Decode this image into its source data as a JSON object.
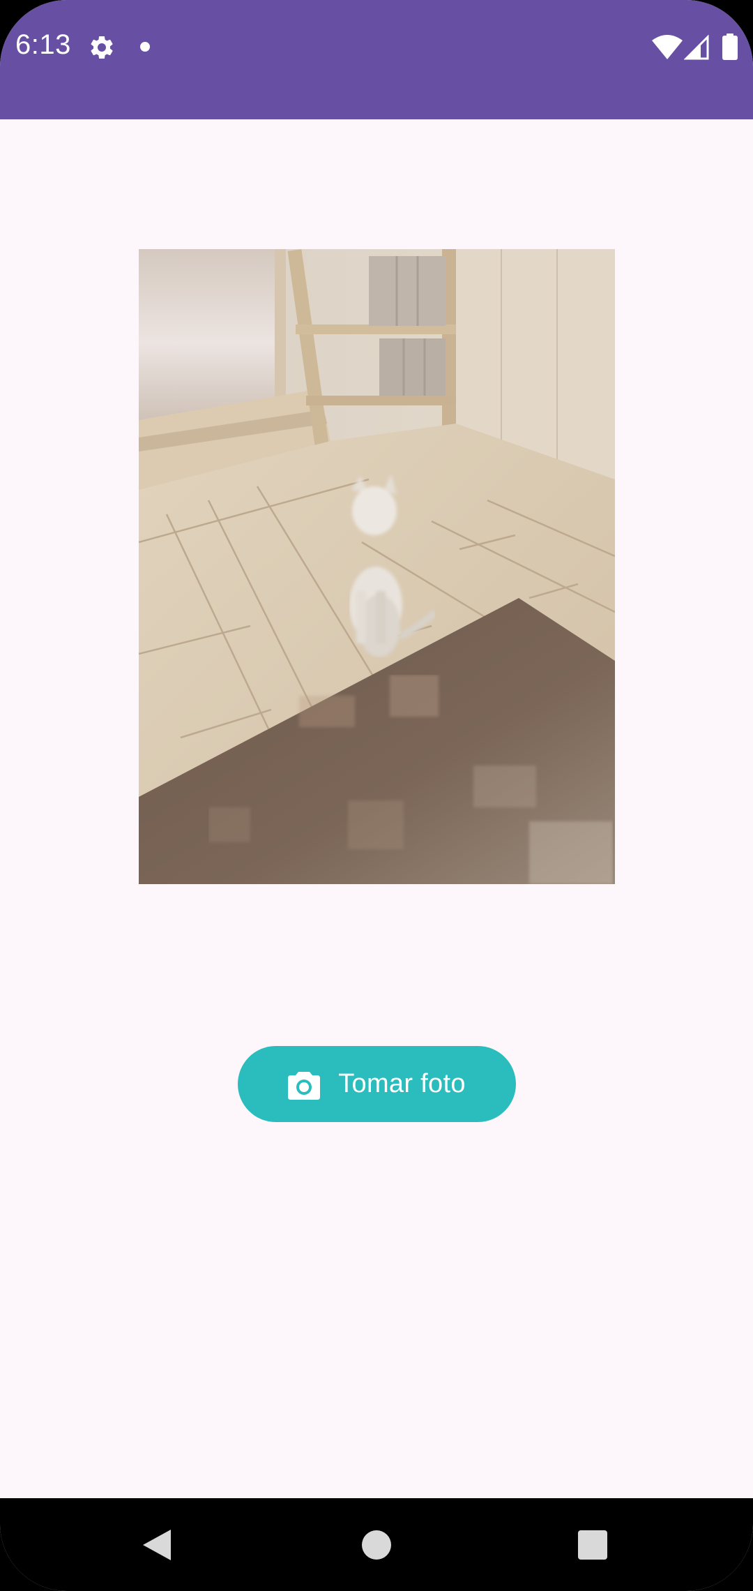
{
  "status_bar": {
    "time": "6:13",
    "background_color": "#6750a4",
    "icons": [
      "gear-icon",
      "notification-dot-icon",
      "wifi-icon",
      "cellular-signal-icon",
      "battery-icon"
    ]
  },
  "main": {
    "background_color": "#fdf7fb",
    "photo": {
      "subject": "cat-in-room-photo"
    },
    "take_photo_button": {
      "label": "Tomar foto",
      "icon": "camera-icon",
      "color": "#2bbdbd"
    }
  },
  "nav_bar": {
    "icons": [
      "back-triangle-icon",
      "home-circle-icon",
      "recents-square-icon"
    ]
  }
}
